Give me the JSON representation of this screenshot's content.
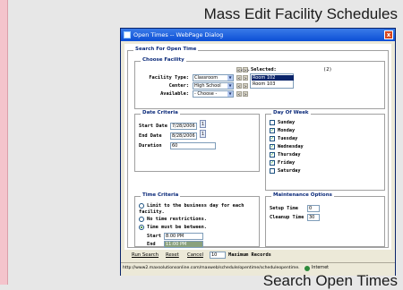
{
  "slide": {
    "title": "Mass Edit Facility Schedules",
    "footer": "Search Open Times"
  },
  "window": {
    "title": "Open Times -- WebPage Dialog",
    "close_glyph": "x"
  },
  "search": {
    "legend": "Search For Open Time",
    "choose_facility": {
      "legend": "Choose Facility",
      "facility_type_label": "Facility Type:",
      "facility_type_value": "Classroom",
      "center_label": "Center:",
      "center_value": "High School",
      "available_label": "Available:",
      "available_value": "- Choose -",
      "move_all_left": "<<",
      "move_all_right": ">>",
      "move_left": "<",
      "move_right": ">",
      "selected_label": "Selected:",
      "selected_count": "(2)",
      "selected_items": [
        "Room 102",
        "Room 103"
      ]
    },
    "date_criteria": {
      "legend": "Date Criteria",
      "start_label": "Start Date",
      "start_value": "7/28/2006",
      "end_label": "End Date",
      "end_value": "8/28/2006",
      "duration_label": "Duration",
      "duration_value": "60"
    },
    "day_of_week": {
      "legend": "Day Of Week",
      "days": [
        {
          "label": "Sunday",
          "checked": false
        },
        {
          "label": "Monday",
          "checked": true
        },
        {
          "label": "Tuesday",
          "checked": true
        },
        {
          "label": "Wednesday",
          "checked": true
        },
        {
          "label": "Thursday",
          "checked": true
        },
        {
          "label": "Friday",
          "checked": true
        },
        {
          "label": "Saturday",
          "checked": false
        }
      ]
    },
    "time_criteria": {
      "legend": "Time Criteria",
      "opt1_line1": "Limit to the business day for each",
      "opt1_line2": "facility.",
      "opt2": "No time restrictions.",
      "opt3": "Time must be between.",
      "start_label": "Start",
      "start_value": "8:00 PM",
      "end_label": "End",
      "end_value": "11:00 PM"
    },
    "maintenance": {
      "legend": "Maintenance Options",
      "setup_label": "Setup Time",
      "setup_value": "0",
      "cleanup_label": "Cleanup Time",
      "cleanup_value": "30"
    }
  },
  "buttons": {
    "run_search": "Run Search",
    "reset": "Reset",
    "cancel": "Cancel",
    "max_value": "10",
    "max_label": "Maximum Records"
  },
  "status": {
    "url": "http://www2.maxsolutionsonline.com/maxweb/schedule/opentime/scheduleopentime.",
    "zone": "Internet"
  },
  "colors": {
    "titlebar": "#0c4fd6",
    "legend_text": "#0b2a7a",
    "check": "#21a121",
    "selection": "#0a246a"
  }
}
